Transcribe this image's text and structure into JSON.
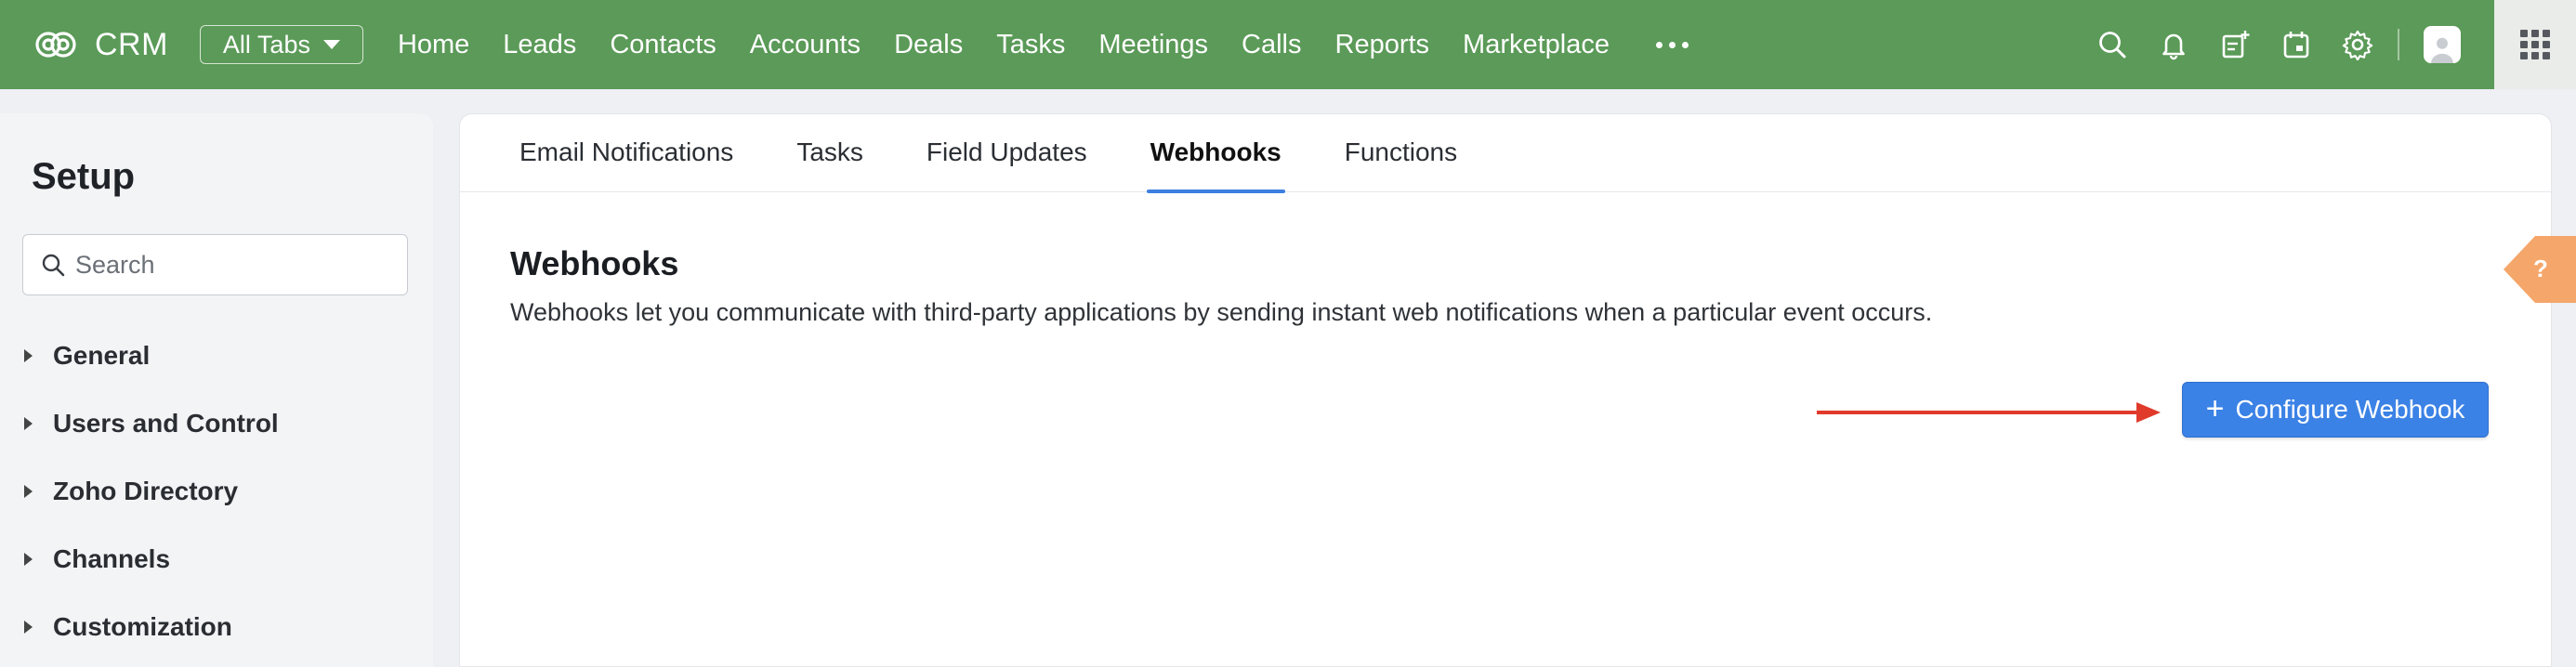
{
  "topbar": {
    "app_name": "CRM",
    "all_tabs_label": "All Tabs",
    "nav_items": [
      "Home",
      "Leads",
      "Contacts",
      "Accounts",
      "Deals",
      "Tasks",
      "Meetings",
      "Calls",
      "Reports",
      "Marketplace"
    ],
    "icons": [
      "search-icon",
      "bell-icon",
      "add-note-icon",
      "calendar-icon",
      "gear-icon"
    ],
    "color": "#5b9a58"
  },
  "sidebar": {
    "title": "Setup",
    "search_placeholder": "Search",
    "items": [
      "General",
      "Users and Control",
      "Zoho Directory",
      "Channels",
      "Customization"
    ]
  },
  "main": {
    "tabs": [
      {
        "label": "Email Notifications",
        "active": false
      },
      {
        "label": "Tasks",
        "active": false
      },
      {
        "label": "Field Updates",
        "active": false
      },
      {
        "label": "Webhooks",
        "active": true
      },
      {
        "label": "Functions",
        "active": false
      }
    ],
    "title": "Webhooks",
    "description": "Webhooks let you communicate with third-party applications by sending instant web notifications when a particular event occurs.",
    "configure_button_label": "Configure Webhook",
    "accent_color": "#3b82e6",
    "annotation_arrow_color": "#e03a2b",
    "help_label": "?"
  }
}
